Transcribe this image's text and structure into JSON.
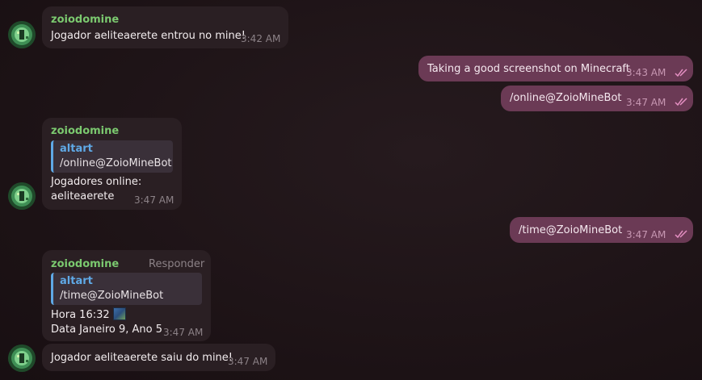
{
  "messages": {
    "m1": {
      "sender": "zoiodomine",
      "text": "Jogador aeliteaerete entrou no mine!",
      "time": "3:42 AM"
    },
    "m2": {
      "text": "Taking a good screenshot on Minecraft",
      "time": "3:43 AM"
    },
    "m3": {
      "text": "/online@ZoioMineBot",
      "time": "3:47 AM"
    },
    "m4": {
      "sender": "zoiodomine",
      "reply_name": "altart",
      "reply_text": "/online@ZoioMineBot",
      "line1": "Jogadores online:",
      "line2": "aeliteaerete",
      "time": "3:47 AM"
    },
    "m5": {
      "text": "/time@ZoioMineBot",
      "time": "3:47 AM"
    },
    "m6": {
      "sender": "zoiodomine",
      "responder": "Responder",
      "reply_name": "altart",
      "reply_text": "/time@ZoioMineBot",
      "line1": "Hora 16:32",
      "line2": "Data Janeiro 9, Ano 5",
      "time": "3:47 AM"
    },
    "m7": {
      "text": "Jogador aeliteaerete saiu do mine!",
      "time": "3:47 AM"
    }
  },
  "colors": {
    "incoming_bubble": "#2a1f23",
    "outgoing_bubble": "#6b3a55",
    "sender": "#7bc96f",
    "reply_accent": "#5fa9e6",
    "read_check": "#e58fc2"
  },
  "icons": [
    "ender-eye-avatar-icon",
    "read-double-check-icon",
    "clock-item-icon"
  ]
}
